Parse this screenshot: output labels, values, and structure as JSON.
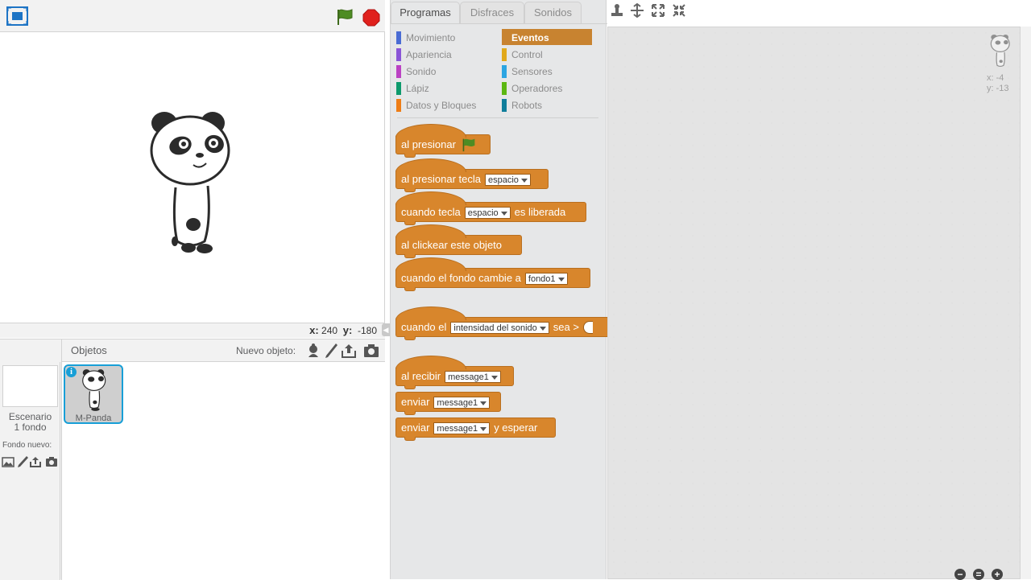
{
  "stage": {
    "coords": {
      "x_label": "x:",
      "x_value": "240",
      "y_label": "y:",
      "y_value": "-180"
    }
  },
  "sprites_pane": {
    "title": "Objetos",
    "new_sprite_label": "Nuevo objeto:",
    "stage_name": "Escenario",
    "stage_backdrops": "1 fondo",
    "new_backdrop_label": "Fondo nuevo:",
    "sprites": [
      {
        "name": "M-Panda",
        "info": "i"
      }
    ]
  },
  "tabs": [
    {
      "label": "Programas",
      "active": true
    },
    {
      "label": "Disfraces",
      "active": false
    },
    {
      "label": "Sonidos",
      "active": false
    }
  ],
  "categories": {
    "left": [
      {
        "label": "Movimiento",
        "color": "#4a6cd4"
      },
      {
        "label": "Apariencia",
        "color": "#8a55d7"
      },
      {
        "label": "Sonido",
        "color": "#bb42c3"
      },
      {
        "label": "Lápiz",
        "color": "#0e9a6c"
      },
      {
        "label": "Datos y Bloques",
        "color": "#ee7d16"
      }
    ],
    "right": [
      {
        "label": "Eventos",
        "color": "#c88330",
        "selected": true
      },
      {
        "label": "Control",
        "color": "#e1a91a"
      },
      {
        "label": "Sensores",
        "color": "#2ca5e2"
      },
      {
        "label": "Operadores",
        "color": "#5cb712"
      },
      {
        "label": "Robots",
        "color": "#0f7e9b"
      }
    ]
  },
  "blocks": {
    "when_flag": {
      "text": "al presionar"
    },
    "when_key": {
      "text": "al presionar tecla",
      "dropdown": "espacio"
    },
    "when_key_released": {
      "text1": "cuando tecla",
      "dropdown": "espacio",
      "text2": "es liberada"
    },
    "when_clicked": {
      "text": "al clickear este objeto"
    },
    "when_backdrop": {
      "text": "cuando el fondo cambie a",
      "dropdown": "fondo1"
    },
    "when_sensor": {
      "text1": "cuando el",
      "dropdown": "intensidad del sonido",
      "text2": "sea >"
    },
    "when_receive": {
      "text": "al recibir",
      "dropdown": "message1"
    },
    "broadcast": {
      "text": "enviar",
      "dropdown": "message1"
    },
    "broadcast_wait": {
      "text1": "enviar",
      "dropdown": "message1",
      "text2": "y esperar"
    }
  },
  "script_area": {
    "sprite_x": "x: -4",
    "sprite_y": "y: -13"
  },
  "colors": {
    "events": "#d8862c",
    "accent": "#179fd7",
    "stop": "#e0211d",
    "flag": "#4e8c23"
  }
}
